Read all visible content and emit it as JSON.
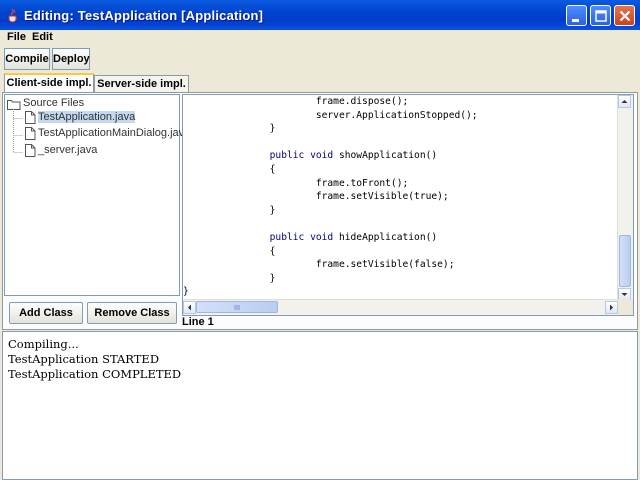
{
  "window": {
    "title": "Editing: TestApplication [Application]",
    "minimize_icon": "minimize-icon",
    "maximize_icon": "maximize-icon",
    "close_icon": "close-icon"
  },
  "menu": {
    "items": [
      {
        "label": "File"
      },
      {
        "label": "Edit"
      }
    ]
  },
  "toolbar": {
    "compile_label": "Compile",
    "deploy_label": "Deploy"
  },
  "tabs": [
    {
      "label": "Client-side impl.",
      "active": true
    },
    {
      "label": "Server-side impl.",
      "active": false
    }
  ],
  "tree": {
    "root": "Source Files",
    "files": [
      {
        "name": "TestApplication.java",
        "selected": true
      },
      {
        "name": "TestApplicationMainDialog.java",
        "selected": false
      },
      {
        "name": "_server.java",
        "selected": false
      }
    ]
  },
  "editor": {
    "lines": [
      {
        "indent": "            ",
        "text": "frame.dispose();"
      },
      {
        "indent": "            ",
        "text": "server.ApplicationStopped();"
      },
      {
        "indent": "    ",
        "text": "}"
      },
      {
        "indent": "",
        "text": ""
      },
      {
        "indent": "    ",
        "text": "public void showApplication()"
      },
      {
        "indent": "    ",
        "text": "{"
      },
      {
        "indent": "            ",
        "text": "frame.toFront();"
      },
      {
        "indent": "            ",
        "text": "frame.setVisible(true);"
      },
      {
        "indent": "    ",
        "text": "}"
      },
      {
        "indent": "",
        "text": ""
      },
      {
        "indent": "    ",
        "text": "public void hideApplication()"
      },
      {
        "indent": "    ",
        "text": "{"
      },
      {
        "indent": "            ",
        "text": "frame.setVisible(false);"
      },
      {
        "indent": "    ",
        "text": "}"
      },
      {
        "indent": "",
        "text": "}"
      }
    ]
  },
  "buttons": {
    "add_class": "Add Class",
    "remove_class": "Remove Class"
  },
  "status": {
    "line": "Line 1"
  },
  "console": {
    "lines": [
      "Compiling...",
      "TestApplication STARTED",
      "TestApplication COMPLETED"
    ]
  }
}
